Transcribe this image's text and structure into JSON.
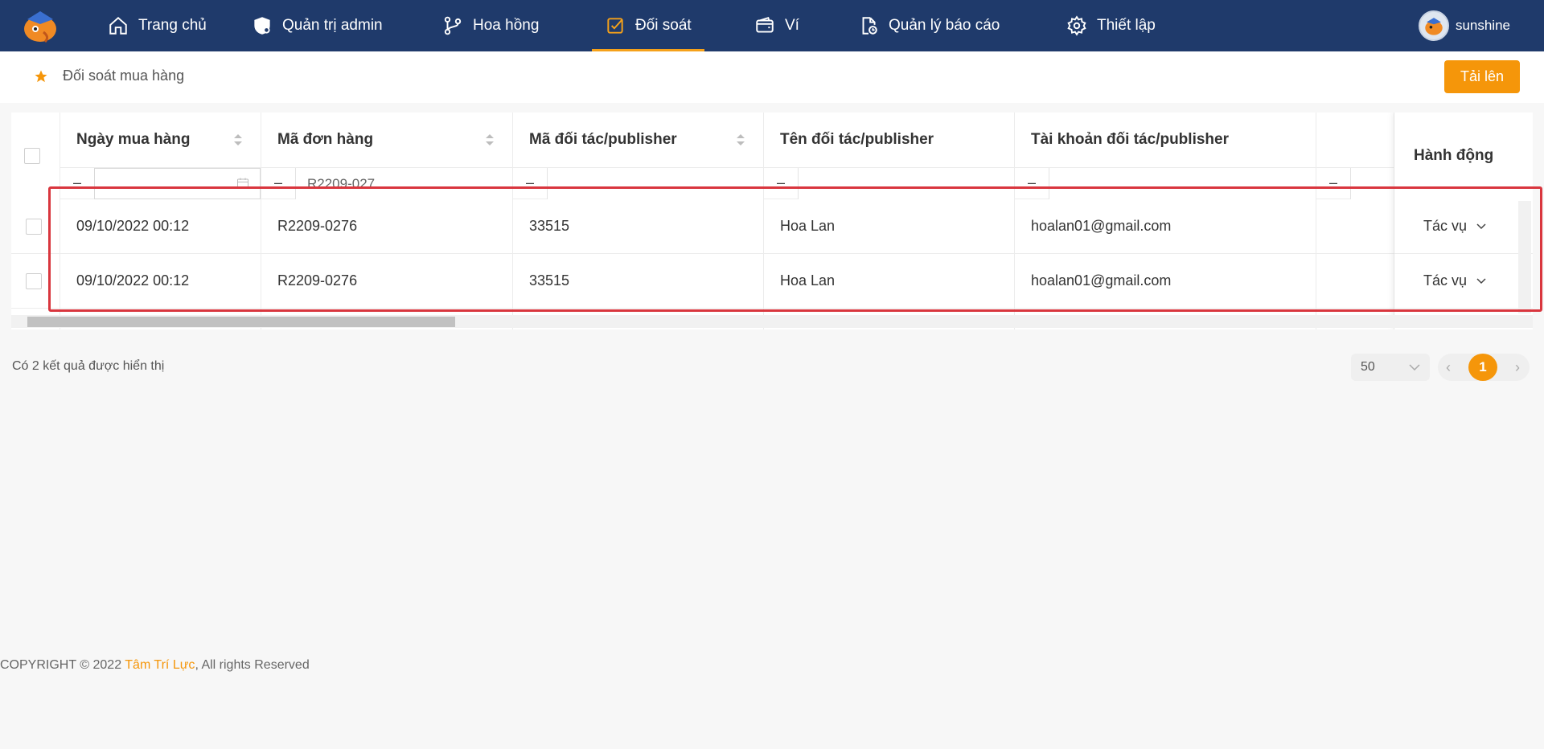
{
  "nav": {
    "items": [
      {
        "label": "Trang chủ",
        "icon": "home-icon"
      },
      {
        "label": "Quản trị admin",
        "icon": "shield-icon"
      },
      {
        "label": "Hoa hồng",
        "icon": "branch-icon"
      },
      {
        "label": "Đối soát",
        "icon": "checkbox-icon",
        "active": true
      },
      {
        "label": "Ví",
        "icon": "wallet-icon"
      },
      {
        "label": "Quản lý báo cáo",
        "icon": "report-icon"
      },
      {
        "label": "Thiết lập",
        "icon": "gear-icon"
      }
    ],
    "username": "sunshine"
  },
  "breadcrumb": {
    "label": "Đối soát mua hàng",
    "icon": "star-icon"
  },
  "toolbar": {
    "upload_label": "Tải lên"
  },
  "table": {
    "columns": [
      "Ngày mua hàng",
      "Mã đơn hàng",
      "Mã đối tác/publisher",
      "Tên đối tác/publisher",
      "Tài khoản đối tác/publisher",
      "",
      "Hành động"
    ],
    "filters": {
      "operator": "–",
      "order_code": "R2209-027"
    },
    "rows": [
      {
        "date": "09/10/2022 00:12",
        "order": "R2209-0276",
        "partner_code": "33515",
        "partner_name": "Hoa Lan",
        "account": "hoalan01@gmail.com",
        "action": "Tác vụ"
      },
      {
        "date": "09/10/2022 00:12",
        "order": "R2209-0276",
        "partner_code": "33515",
        "partner_name": "Hoa Lan",
        "account": "hoalan01@gmail.com",
        "action": "Tác vụ"
      }
    ]
  },
  "footer": {
    "result_text": "Có 2 kết quả được hiển thị",
    "page_size": "50",
    "current_page": "1"
  },
  "copyright": {
    "prefix": "COPYRIGHT © 2022 ",
    "brand": "Tâm Trí Lực",
    "suffix": ", All rights Reserved"
  },
  "colors": {
    "nav_bg": "#1f3a6b",
    "accent": "#f5960a",
    "highlight": "#d9363e"
  }
}
